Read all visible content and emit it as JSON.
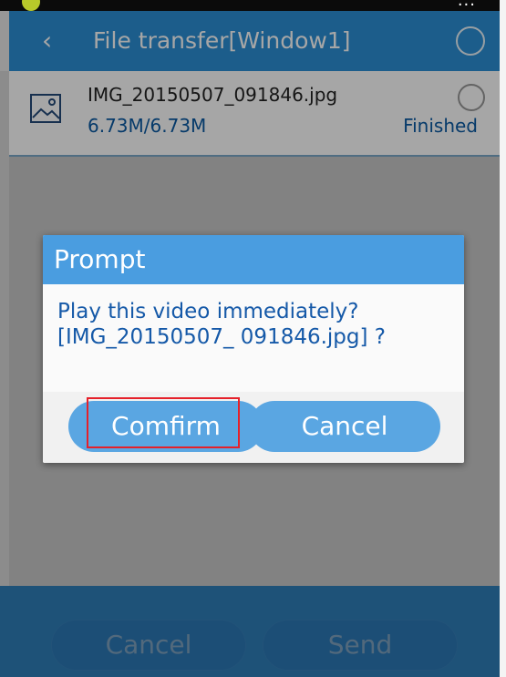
{
  "statusbar": {
    "text": "..."
  },
  "header": {
    "back_icon": "back-arrow-icon",
    "title": "File transfer[Window1]"
  },
  "transfer": {
    "file_name": "IMG_20150507_091846.jpg",
    "size": "6.73M/6.73M",
    "status": "Finished",
    "icon": "image-file-icon"
  },
  "bottom": {
    "cancel_label": "Cancel",
    "send_label": "Send"
  },
  "dialog": {
    "title": "Prompt",
    "message": "Play this video immediately?[IMG_20150507_ 091846.jpg] ?",
    "confirm_label": "Comfirm",
    "cancel_label": "Cancel"
  },
  "colors": {
    "header_bg": "#2c8fd6",
    "dialog_title_bg": "#4a9de0",
    "dialog_button_bg": "#5aa6e2",
    "highlight": "#e5202a"
  }
}
